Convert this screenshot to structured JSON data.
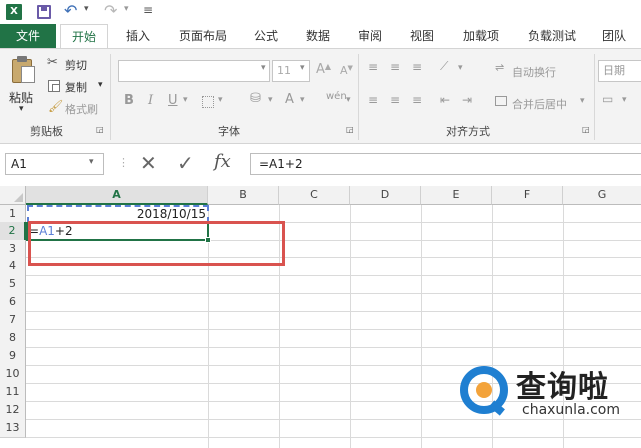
{
  "titlebar": {
    "undo_arrow": "↶",
    "redo_arrow": "↷",
    "qat_more": "≡"
  },
  "tabs": [
    "文件",
    "开始",
    "插入",
    "页面布局",
    "公式",
    "数据",
    "审阅",
    "视图",
    "加载项",
    "负载测试",
    "团队"
  ],
  "ribbon": {
    "paste": "粘贴",
    "cut": "剪切",
    "copy": "复制",
    "format_painter": "格式刷",
    "clipboard_group": "剪贴板",
    "font_size": "11",
    "font_group": "字体",
    "bold": "B",
    "italic": "I",
    "underline": "U",
    "wrap_text": "自动换行",
    "merge_center": "合并后居中",
    "alignment_group": "对齐方式",
    "number_format": "日期"
  },
  "formula_bar": {
    "name_box": "A1",
    "formula": "=A1+2",
    "fx": "fx"
  },
  "columns": [
    "A",
    "B",
    "C",
    "D",
    "E",
    "F",
    "G"
  ],
  "rows": [
    "1",
    "2",
    "3",
    "4",
    "5",
    "6",
    "7",
    "8",
    "9",
    "10",
    "11",
    "12",
    "13"
  ],
  "cells": {
    "A1": "2018/10/15",
    "A2_eq": "=",
    "A2_ref": "A1",
    "A2_rest": "+2"
  },
  "watermark": {
    "brand": "查询啦",
    "url": "chaxunla.com"
  },
  "colors": {
    "excel_green": "#217346",
    "highlight_red": "#d9534f",
    "ref_blue": "#5b7fd6",
    "watermark_blue": "#1f7fd1"
  }
}
